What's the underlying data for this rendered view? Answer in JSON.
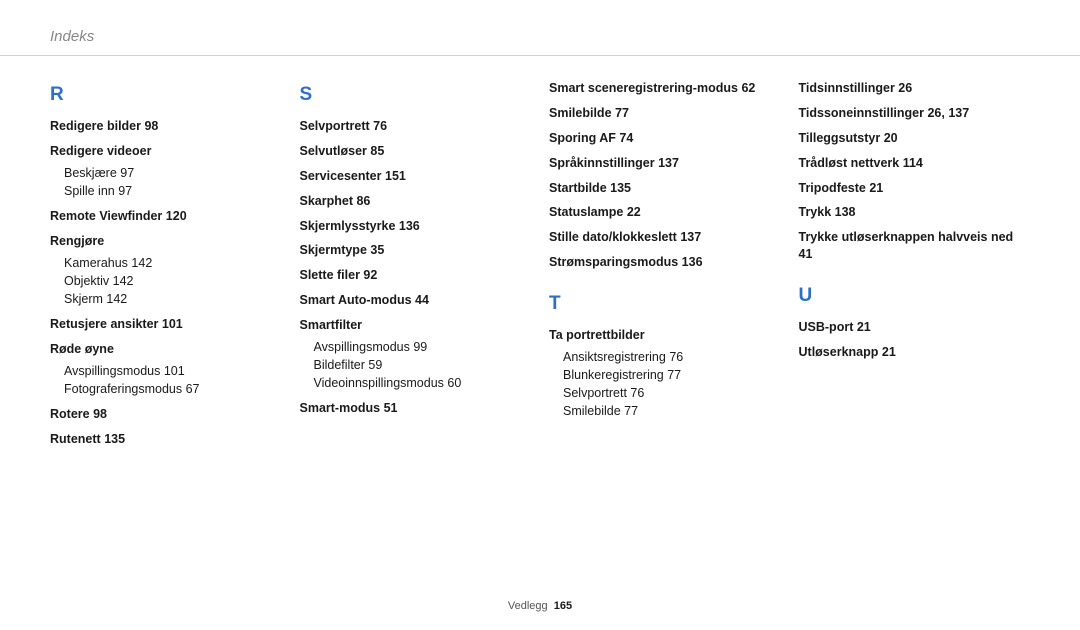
{
  "header_title": "Indeks",
  "footer_label": "Vedlegg",
  "footer_page": "165",
  "cols": [
    {
      "sections": [
        {
          "letter": "R",
          "items": [
            {
              "t": "bold",
              "label": "Redigere bilder",
              "page": "98"
            },
            {
              "t": "group",
              "label": "Redigere videoer",
              "subs": [
                {
                  "label": "Beskjære",
                  "page": "97"
                },
                {
                  "label": "Spille inn",
                  "page": "97"
                }
              ]
            },
            {
              "t": "bold",
              "label": "Remote Viewfinder",
              "page": "120"
            },
            {
              "t": "group",
              "label": "Rengjøre",
              "subs": [
                {
                  "label": "Kamerahus",
                  "page": "142"
                },
                {
                  "label": "Objektiv",
                  "page": "142"
                },
                {
                  "label": "Skjerm",
                  "page": "142"
                }
              ]
            },
            {
              "t": "bold",
              "label": "Retusjere ansikter",
              "page": "101"
            },
            {
              "t": "group",
              "label": "Røde øyne",
              "subs": [
                {
                  "label": "Avspillingsmodus",
                  "page": "101"
                },
                {
                  "label": "Fotograferingsmodus",
                  "page": "67"
                }
              ]
            },
            {
              "t": "bold",
              "label": "Rotere",
              "page": "98"
            },
            {
              "t": "bold",
              "label": "Rutenett",
              "page": "135"
            }
          ]
        }
      ]
    },
    {
      "sections": [
        {
          "letter": "S",
          "items": [
            {
              "t": "bold",
              "label": "Selvportrett",
              "page": "76"
            },
            {
              "t": "bold",
              "label": "Selvutløser",
              "page": "85"
            },
            {
              "t": "bold",
              "label": "Servicesenter",
              "page": "151"
            },
            {
              "t": "bold",
              "label": "Skarphet",
              "page": "86"
            },
            {
              "t": "bold",
              "label": "Skjermlysstyrke",
              "page": "136"
            },
            {
              "t": "bold",
              "label": "Skjermtype",
              "page": "35"
            },
            {
              "t": "bold",
              "label": "Slette filer",
              "page": "92"
            },
            {
              "t": "bold",
              "label": "Smart Auto-modus",
              "page": "44"
            },
            {
              "t": "group",
              "label": "Smartfilter",
              "subs": [
                {
                  "label": "Avspillingsmodus",
                  "page": "99"
                },
                {
                  "label": "Bildefilter",
                  "page": "59"
                },
                {
                  "label": "Videoinnspillingsmodus",
                  "page": "60"
                }
              ]
            },
            {
              "t": "bold",
              "label": "Smart-modus",
              "page": "51"
            }
          ]
        }
      ]
    },
    {
      "sections": [
        {
          "letter": "",
          "items": [
            {
              "t": "bold",
              "label": "Smart sceneregistrering-modus",
              "page": "62"
            },
            {
              "t": "bold",
              "label": "Smilebilde",
              "page": "77"
            },
            {
              "t": "bold",
              "label": "Sporing AF",
              "page": "74"
            },
            {
              "t": "bold",
              "label": "Språkinnstillinger",
              "page": "137"
            },
            {
              "t": "bold",
              "label": "Startbilde",
              "page": "135"
            },
            {
              "t": "bold",
              "label": "Statuslampe",
              "page": "22"
            },
            {
              "t": "bold",
              "label": "Stille dato/klokkeslett",
              "page": "137"
            },
            {
              "t": "bold",
              "label": "Strømsparingsmodus",
              "page": "136"
            }
          ]
        },
        {
          "letter": "T",
          "items": [
            {
              "t": "group",
              "label": "Ta portrettbilder",
              "subs": [
                {
                  "label": "Ansiktsregistrering",
                  "page": "76"
                },
                {
                  "label": "Blunkeregistrering",
                  "page": "77"
                },
                {
                  "label": "Selvportrett",
                  "page": "76"
                },
                {
                  "label": "Smilebilde",
                  "page": "77"
                }
              ]
            }
          ]
        }
      ]
    },
    {
      "sections": [
        {
          "letter": "",
          "items": [
            {
              "t": "bold",
              "label": "Tidsinnstillinger",
              "page": "26"
            },
            {
              "t": "bold",
              "label": "Tidssoneinnstillinger",
              "page": "26, 137"
            },
            {
              "t": "bold",
              "label": "Tilleggsutstyr",
              "page": "20"
            },
            {
              "t": "bold",
              "label": "Trådløst nettverk",
              "page": "114"
            },
            {
              "t": "bold",
              "label": "Tripodfeste",
              "page": "21"
            },
            {
              "t": "bold",
              "label": "Trykk",
              "page": "138"
            },
            {
              "t": "bold",
              "label": "Trykke utløserknappen halvveis ned",
              "page": "41"
            }
          ]
        },
        {
          "letter": "U",
          "items": [
            {
              "t": "bold",
              "label": "USB-port",
              "page": "21"
            },
            {
              "t": "bold",
              "label": "Utløserknapp",
              "page": "21"
            }
          ]
        }
      ]
    }
  ]
}
